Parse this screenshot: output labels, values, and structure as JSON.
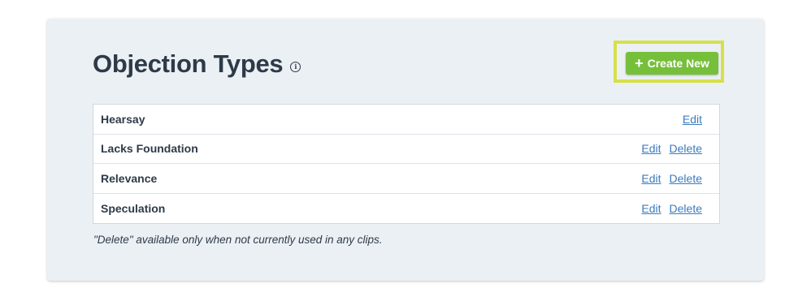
{
  "header": {
    "title": "Objection Types",
    "info_icon": "info-icon",
    "create_label": "Create New",
    "create_icon": "plus-icon"
  },
  "colors": {
    "card_bg": "#ebf0f4",
    "title": "#2e3a48",
    "button": "#76bf3b",
    "highlight": "#d6e04a",
    "link": "#3a7bbf"
  },
  "table": {
    "rows": [
      {
        "name": "Hearsay",
        "edit": "Edit"
      },
      {
        "name": "Lacks Foundation",
        "edit": "Edit",
        "delete": "Delete"
      },
      {
        "name": "Relevance",
        "edit": "Edit",
        "delete": "Delete"
      },
      {
        "name": "Speculation",
        "edit": "Edit",
        "delete": "Delete"
      }
    ]
  },
  "footnote": "\"Delete\" available only when not currently used in any clips."
}
